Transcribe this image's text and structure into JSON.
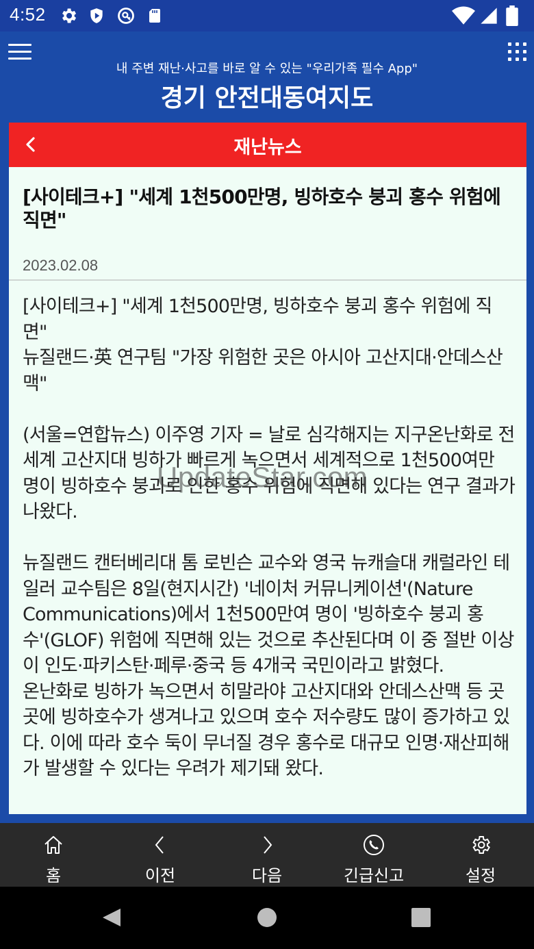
{
  "status_bar": {
    "time": "4:52",
    "left_icons": [
      "gear-icon",
      "shield-play-icon",
      "vpn-key-icon",
      "sd-card-icon"
    ],
    "right_icons": [
      "wifi-icon",
      "signal-icon",
      "battery-icon"
    ]
  },
  "header": {
    "tagline": "내 주변 재난·사고를 바로 알 수 있는 \"우리가족 필수 App\"",
    "title": "경기 안전대동여지도"
  },
  "section": {
    "title": "재난뉴스",
    "accent_color": "#F02323"
  },
  "article": {
    "headline": "[사이테크+] \"세계 1천500만명, 빙하호수 붕괴 홍수 위험에 직면\"",
    "date": "2023.02.08",
    "paragraphs": [
      "[사이테크+] \"세계 1천500만명, 빙하호수 붕괴 홍수 위험에 직면\"",
      "뉴질랜드·英 연구팀 \"가장 위험한 곳은 아시아 고산지대·안데스산맥\"",
      "",
      "(서울=연합뉴스) 이주영 기자 = 날로 심각해지는 지구온난화로 전 세계 고산지대 빙하가 빠르게 녹으면서 세계적으로 1천500여만 명이 빙하호수 붕괴로 인한 홍수 위험에 직면해 있다는 연구 결과가 나왔다.",
      "",
      "뉴질랜드 캔터베리대 톰 로빈슨 교수와 영국 뉴캐슬대 캐럴라인 테일러 교수팀은 8일(현지시간) '네이처 커뮤니케이션'(Nature Communications)에서 1천500만여 명이 '빙하호수 붕괴 홍수'(GLOF) 위험에 직면해 있는 것으로 추산된다며 이 중 절반 이상이 인도·파키스탄·페루·중국 등 4개국 국민이라고 밝혔다.",
      "온난화로 빙하가 녹으면서 히말라야 고산지대와 안데스산맥 등 곳곳에 빙하호수가 생겨나고 있으며 호수 저수량도 많이 증가하고 있다. 이에 따라 호수 둑이 무너질 경우 홍수로 대규모 인명·재산피해가 발생할 수 있다는 우려가 제기돼 왔다."
    ],
    "watermark": "UpdateStar.com"
  },
  "bottom_nav": [
    {
      "label": "홈",
      "icon": "home-icon"
    },
    {
      "label": "이전",
      "icon": "chevron-left-icon"
    },
    {
      "label": "다음",
      "icon": "chevron-right-icon"
    },
    {
      "label": "긴급신고",
      "icon": "phone-icon"
    },
    {
      "label": "설정",
      "icon": "gear-icon"
    }
  ],
  "system_nav": [
    "back-icon",
    "home-circle-icon",
    "recents-icon"
  ]
}
